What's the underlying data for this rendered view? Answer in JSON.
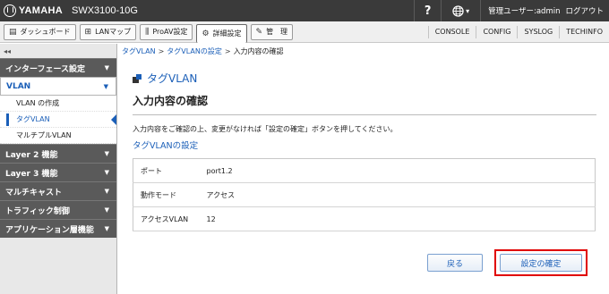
{
  "topbar": {
    "brand": "YAMAHA",
    "model": "SWX3100-10G",
    "help": "?",
    "globe_caret": "▾",
    "user_label": "管理ユーザー:admin",
    "logout": "ログアウト"
  },
  "tabs": [
    {
      "icon": "▤",
      "label": "ダッシュボード"
    },
    {
      "icon": "⊞",
      "label": "LANマップ"
    },
    {
      "icon": "⫼",
      "label": "ProAV設定"
    },
    {
      "icon": "⚙",
      "label": "詳細設定"
    },
    {
      "icon": "✎",
      "label": "管　理"
    }
  ],
  "right_links": [
    "CONSOLE",
    "CONFIG",
    "SYSLOG",
    "TECHINFO"
  ],
  "sidebar": {
    "collapse": "◂◂",
    "caret": "▼",
    "sections": [
      {
        "label": "インターフェース設定"
      },
      {
        "label": "VLAN"
      },
      {
        "label": "Layer 2 機能"
      },
      {
        "label": "Layer 3 機能"
      },
      {
        "label": "マルチキャスト"
      },
      {
        "label": "トラフィック制御"
      },
      {
        "label": "アプリケーション層機能"
      }
    ],
    "vlan_items": [
      "VLAN の作成",
      "タグVLAN",
      "マルチプルVLAN"
    ]
  },
  "breadcrumb": {
    "items": [
      "タグVLAN",
      "タグVLANの設定",
      "入力内容の確認"
    ],
    "sep": ">"
  },
  "page": {
    "title": "タグVLAN",
    "section_title": "入力内容の確認",
    "description": "入力内容をご確認の上、変更がなければ「設定の確定」ボタンを押してください。",
    "sub_title": "タグVLANの設定"
  },
  "table": [
    {
      "key": "ポート",
      "value": "port1.2"
    },
    {
      "key": "動作モード",
      "value": "アクセス"
    },
    {
      "key": "アクセスVLAN",
      "value": "12"
    }
  ],
  "buttons": {
    "back": "戻る",
    "confirm": "設定の確定"
  },
  "colors": {
    "accent": "#1b5fb8",
    "topbar": "#3a3a3a",
    "sidebar_head": "#5a5a5a",
    "highlight": "#e00000"
  }
}
